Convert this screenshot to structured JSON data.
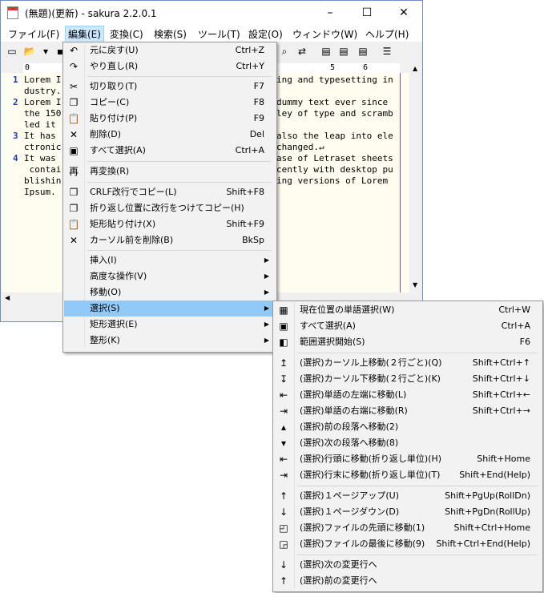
{
  "window": {
    "title": "(無題)(更新) - sakura 2.2.0.1",
    "minimize": "–",
    "maximize": "☐",
    "close": "✕"
  },
  "menubar": [
    "ファイル(F)",
    "編集(E)",
    "変換(C)",
    "検索(S)",
    "ツール(T)",
    "設定(O)",
    "ウィンドウ(W)",
    "ヘルプ(H)"
  ],
  "ruler": {
    "marks": [
      "0",
      "5",
      "6"
    ]
  },
  "editor": {
    "numbers": [
      "1",
      "2",
      "3",
      "4"
    ],
    "left": [
      "Lorem I",
      "dustry.",
      "Lorem I",
      "the 150",
      "led it",
      "It has",
      "ctronic",
      "It was",
      " contai",
      "blishin",
      "Ipsum."
    ],
    "right": [
      "ing and typesetting in",
      "",
      "dummy text ever since",
      "ley of type and scramb",
      "",
      "also the leap into ele",
      "changed.↵",
      "ase of Letraset sheets",
      "cently with desktop pu",
      "ing versions of Lorem",
      ""
    ]
  },
  "edit_menu": [
    {
      "icon": "undo-icon",
      "glyph": "↶",
      "label": "元に戻す(U)",
      "shortcut": "Ctrl+Z"
    },
    {
      "icon": "redo-icon",
      "glyph": "↷",
      "label": "やり直し(R)",
      "shortcut": "Ctrl+Y"
    },
    {
      "icon": "cut-icon",
      "glyph": "✂",
      "label": "切り取り(T)",
      "shortcut": "F7"
    },
    {
      "icon": "copy-icon",
      "glyph": "❐",
      "label": "コピー(C)",
      "shortcut": "F8"
    },
    {
      "icon": "paste-icon",
      "glyph": "📋",
      "label": "貼り付け(P)",
      "shortcut": "F9"
    },
    {
      "icon": "delete-icon",
      "glyph": "✕",
      "label": "削除(D)",
      "shortcut": "Del"
    },
    {
      "icon": "select-all-icon",
      "glyph": "▣",
      "label": "すべて選択(A)",
      "shortcut": "Ctrl+A"
    },
    {
      "icon": "reconvert-icon",
      "glyph": "再",
      "label": "再変換(R)",
      "shortcut": ""
    },
    {
      "icon": "crlf-copy-icon",
      "glyph": "❐",
      "label": "CRLF改行でコピー(L)",
      "shortcut": "Shift+F8"
    },
    {
      "icon": "wrap-copy-icon",
      "glyph": "❐",
      "label": "折り返し位置に改行をつけてコピー(H)",
      "shortcut": ""
    },
    {
      "icon": "box-paste-icon",
      "glyph": "📋",
      "label": "矩形貼り付け(X)",
      "shortcut": "Shift+F9"
    },
    {
      "icon": "delete-back-icon",
      "glyph": "✕",
      "label": "カーソル前を削除(B)",
      "shortcut": "BkSp"
    },
    {
      "icon": "",
      "glyph": "",
      "label": "挿入(I)",
      "shortcut": ""
    },
    {
      "icon": "",
      "glyph": "",
      "label": "高度な操作(V)",
      "shortcut": ""
    },
    {
      "icon": "",
      "glyph": "",
      "label": "移動(O)",
      "shortcut": ""
    },
    {
      "icon": "",
      "glyph": "",
      "label": "選択(S)",
      "shortcut": ""
    },
    {
      "icon": "",
      "glyph": "",
      "label": "矩形選択(E)",
      "shortcut": ""
    },
    {
      "icon": "",
      "glyph": "",
      "label": "整形(K)",
      "shortcut": ""
    }
  ],
  "select_submenu": [
    {
      "icon": "select-word-icon",
      "glyph": "▦",
      "label": "現在位置の単語選択(W)",
      "shortcut": "Ctrl+W"
    },
    {
      "icon": "select-all-icon",
      "glyph": "▣",
      "label": "すべて選択(A)",
      "shortcut": "Ctrl+A"
    },
    {
      "icon": "range-start-icon",
      "glyph": "◧",
      "label": "範囲選択開始(S)",
      "shortcut": "F6"
    },
    {
      "icon": "cursor-up2-icon",
      "glyph": "↥",
      "label": "(選択)カーソル上移動(２行ごと)(Q)",
      "shortcut": "Shift+Ctrl+↑"
    },
    {
      "icon": "cursor-down2-icon",
      "glyph": "↧",
      "label": "(選択)カーソル下移動(２行ごと)(K)",
      "shortcut": "Shift+Ctrl+↓"
    },
    {
      "icon": "word-left-icon",
      "glyph": "⇤",
      "label": "(選択)単語の左端に移動(L)",
      "shortcut": "Shift+Ctrl+←"
    },
    {
      "icon": "word-right-icon",
      "glyph": "⇥",
      "label": "(選択)単語の右端に移動(R)",
      "shortcut": "Shift+Ctrl+→"
    },
    {
      "icon": "para-prev-icon",
      "glyph": "▴",
      "label": "(選択)前の段落へ移動(2)",
      "shortcut": ""
    },
    {
      "icon": "para-next-icon",
      "glyph": "▾",
      "label": "(選択)次の段落へ移動(8)",
      "shortcut": ""
    },
    {
      "icon": "line-home-icon",
      "glyph": "⇤",
      "label": "(選択)行頭に移動(折り返し単位)(H)",
      "shortcut": "Shift+Home"
    },
    {
      "icon": "line-end-icon",
      "glyph": "⇥",
      "label": "(選択)行末に移動(折り返し単位)(T)",
      "shortcut": "Shift+End(Help)"
    },
    {
      "icon": "page-up-icon",
      "glyph": "↑",
      "label": "(選択)１ページアップ(U)",
      "shortcut": "Shift+PgUp(RollDn)"
    },
    {
      "icon": "page-down-icon",
      "glyph": "↓",
      "label": "(選択)１ページダウン(D)",
      "shortcut": "Shift+PgDn(RollUp)"
    },
    {
      "icon": "file-top-icon",
      "glyph": "◰",
      "label": "(選択)ファイルの先頭に移動(1)",
      "shortcut": "Shift+Ctrl+Home"
    },
    {
      "icon": "file-end-icon",
      "glyph": "◲",
      "label": "(選択)ファイルの最後に移動(9)",
      "shortcut": "Shift+Ctrl+End(Help)"
    },
    {
      "icon": "next-change-icon",
      "glyph": "↓",
      "label": "(選択)次の変更行へ",
      "shortcut": ""
    },
    {
      "icon": "prev-change-icon",
      "glyph": "↑",
      "label": "(選択)前の変更行へ",
      "shortcut": ""
    }
  ]
}
